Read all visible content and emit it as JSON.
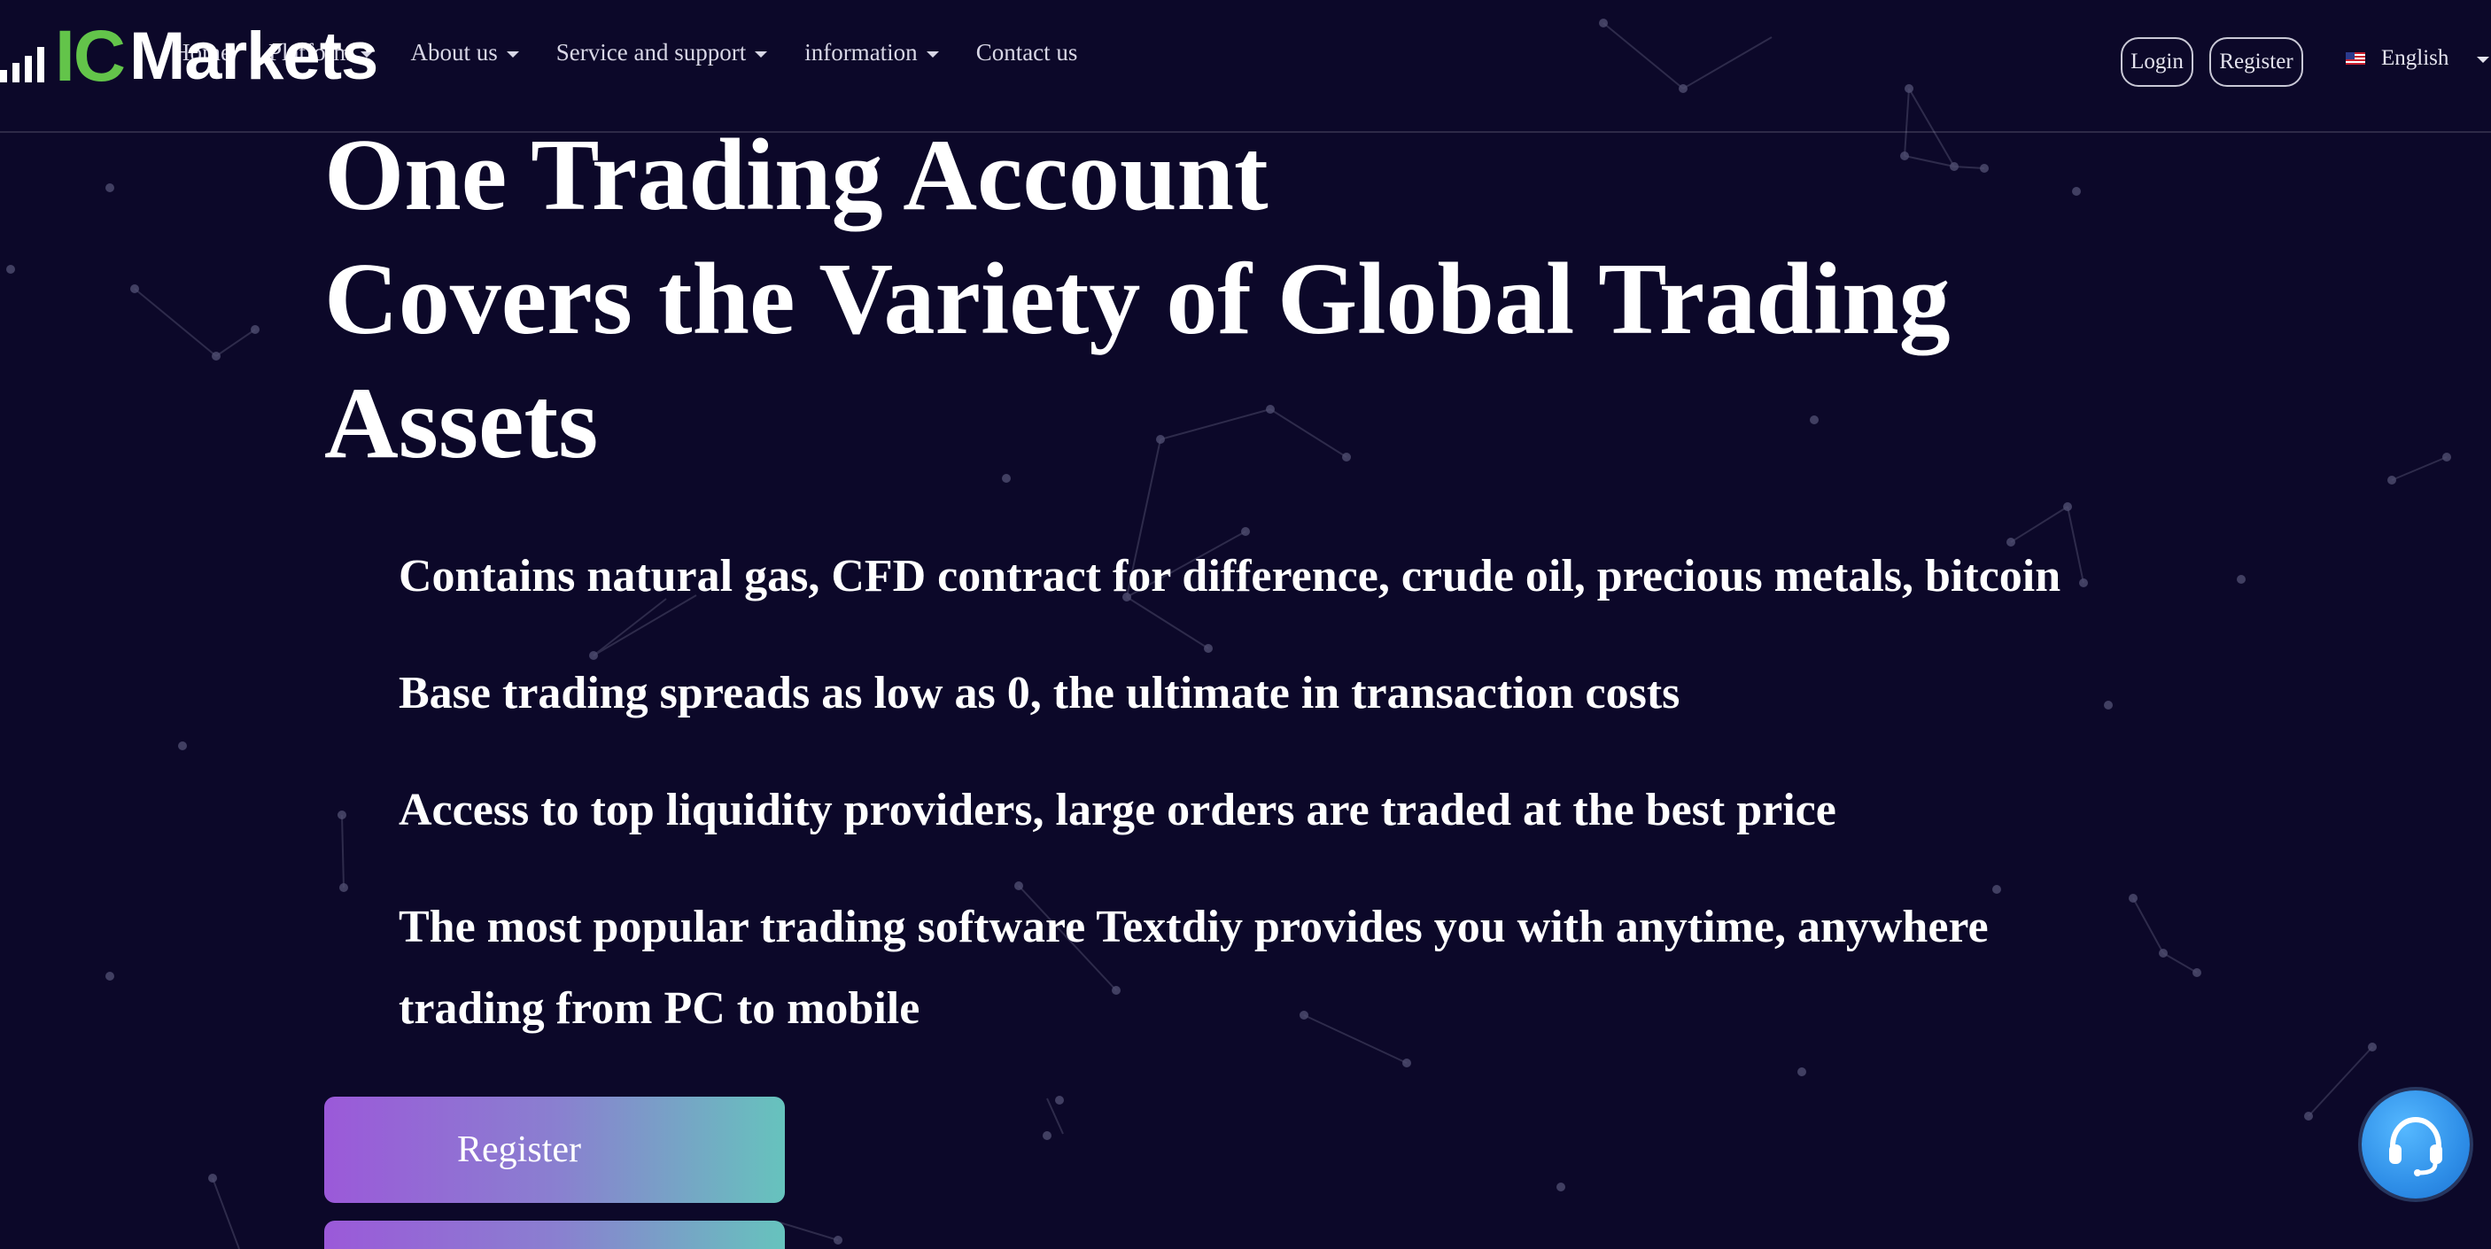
{
  "logo": {
    "brand_prefix": "IC",
    "brand_name": "Markets"
  },
  "nav": {
    "items": [
      {
        "label": "Home",
        "has_dropdown": false
      },
      {
        "label": "Platform",
        "has_dropdown": true
      },
      {
        "label": "About us",
        "has_dropdown": true
      },
      {
        "label": "Service and support",
        "has_dropdown": true
      },
      {
        "label": "information",
        "has_dropdown": true
      },
      {
        "label": "Contact us",
        "has_dropdown": false
      }
    ],
    "login_label": "Login",
    "register_label": "Register",
    "language_label": "English",
    "language_flag": "us-flag-icon"
  },
  "hero": {
    "title_lines": [
      "One Trading Account",
      "Covers the Variety of Global Trading",
      "Assets"
    ],
    "features": [
      "Contains natural gas, CFD contract for difference, crude oil, precious metals, bitcoin",
      "Base trading spreads as low as 0, the ultimate in transaction costs",
      "Access to top liquidity providers, large orders are traded at the best price",
      "The most popular trading software Textdiy provides you with anytime, anywhere trading from PC to mobile"
    ],
    "register_button_label": "Register"
  },
  "support": {
    "icon": "headset-icon"
  },
  "colors": {
    "background": "#0c0829",
    "brand_green": "#63c44a",
    "button_gradient_start": "#9b59d9",
    "button_gradient_end": "#66c3bd",
    "support_blue": "#2f8fe8"
  }
}
